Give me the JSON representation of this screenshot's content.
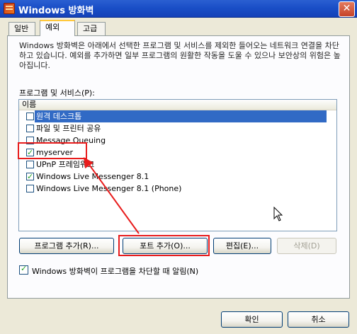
{
  "window": {
    "title": "Windows 방화벽",
    "close": "✕"
  },
  "tabs": [
    {
      "label": "일반"
    },
    {
      "label": "예외"
    },
    {
      "label": "고급"
    }
  ],
  "description": "Windows 방화벽은 아래에서 선택한 프로그램 및 서비스를 제외한 들어오는 네트워크 연결을 차단하고 있습니다. 예외를 추가하면 일부 프로그램의 원활한 작동을 도울 수 있으나 보안상의 위험은 높아집니다.",
  "list": {
    "label": "프로그램 및 서비스(P):",
    "header": "이름",
    "items": [
      {
        "label": "원격 데스크톱",
        "checked": false,
        "selected": true
      },
      {
        "label": "파일 및 프린터 공유",
        "checked": false
      },
      {
        "label": "Message Queuing",
        "checked": false
      },
      {
        "label": "myserver",
        "checked": true
      },
      {
        "label": "UPnP 프레임워크",
        "checked": false
      },
      {
        "label": "Windows Live Messenger 8.1",
        "checked": true
      },
      {
        "label": "Windows Live Messenger 8.1 (Phone)",
        "checked": false
      }
    ]
  },
  "buttons": {
    "add_program": "프로그램 추가(R)...",
    "add_port": "포트 추가(O)...",
    "edit": "편집(E)...",
    "delete": "삭제(D)",
    "ok": "확인",
    "cancel": "취소"
  },
  "notify": {
    "label": "Windows 방화벽이 프로그램을 차단할 때 알림(N)",
    "checked": true
  },
  "colors": {
    "titlebar": "#1a4fc7",
    "selection": "#316ac5",
    "annotation": "#e81c1c",
    "tab_accent": "#ffc83c"
  }
}
